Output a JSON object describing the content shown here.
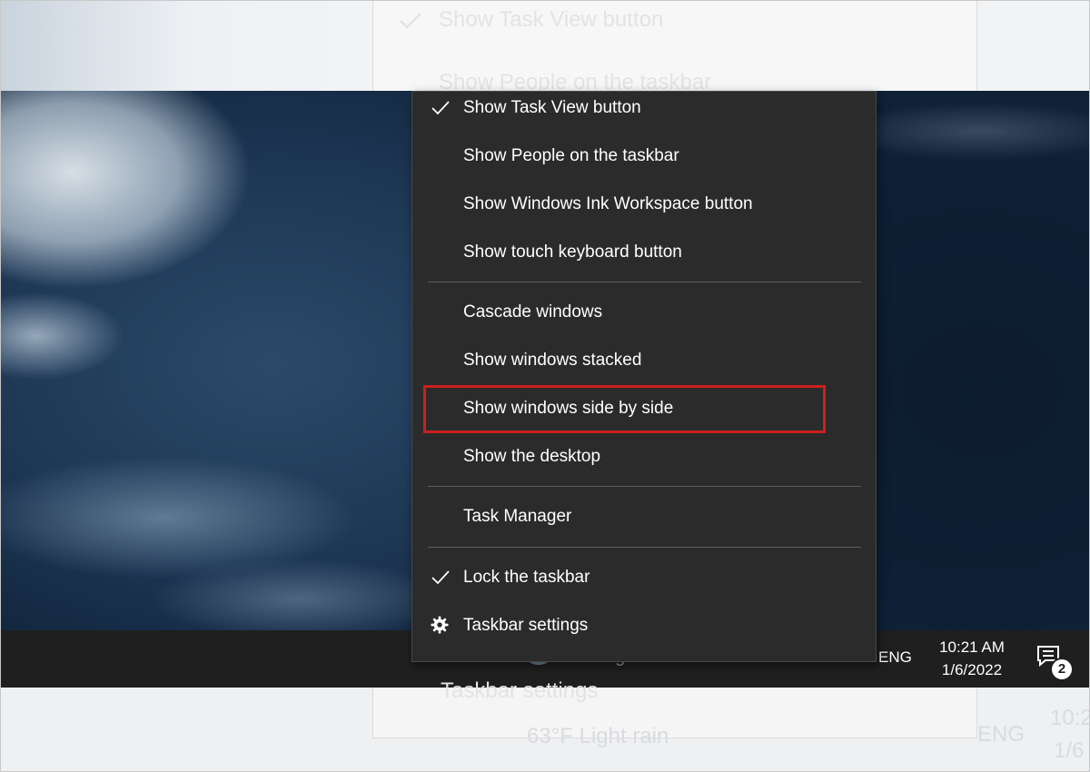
{
  "menu": {
    "items": [
      {
        "label": "Show Task View button",
        "checked": true
      },
      {
        "label": "Show People on the taskbar",
        "checked": false
      },
      {
        "label": "Show Windows Ink Workspace button",
        "checked": false
      },
      {
        "label": "Show touch keyboard button",
        "checked": false
      },
      {
        "label": "Cascade windows",
        "checked": false
      },
      {
        "label": "Show windows stacked",
        "checked": false
      },
      {
        "label": "Show windows side by side",
        "checked": false,
        "highlighted": true
      },
      {
        "label": "Show the desktop",
        "checked": false
      },
      {
        "label": "Task Manager",
        "checked": false
      },
      {
        "label": "Lock the taskbar",
        "checked": true
      },
      {
        "label": "Taskbar settings",
        "icon": "gear-icon"
      }
    ]
  },
  "taskbar": {
    "weather": "63°F  Light rain",
    "language": "ENG",
    "time": "10:21 AM",
    "date": "1/6/2022",
    "notification_count": "2"
  },
  "ghost": {
    "top_line1": "Show Task View button",
    "top_line2": "Show People on the taskbar",
    "bottom_settings": "Taskbar settings",
    "bottom_weather": "63°F  Light rain",
    "bottom_lang": "ENG",
    "bottom_time": "10:2",
    "bottom_date": "1/6"
  },
  "colors": {
    "menu_bg": "#2b2b2b",
    "taskbar_bg": "#1f1f1f",
    "highlight_border": "#cc1f1f"
  }
}
